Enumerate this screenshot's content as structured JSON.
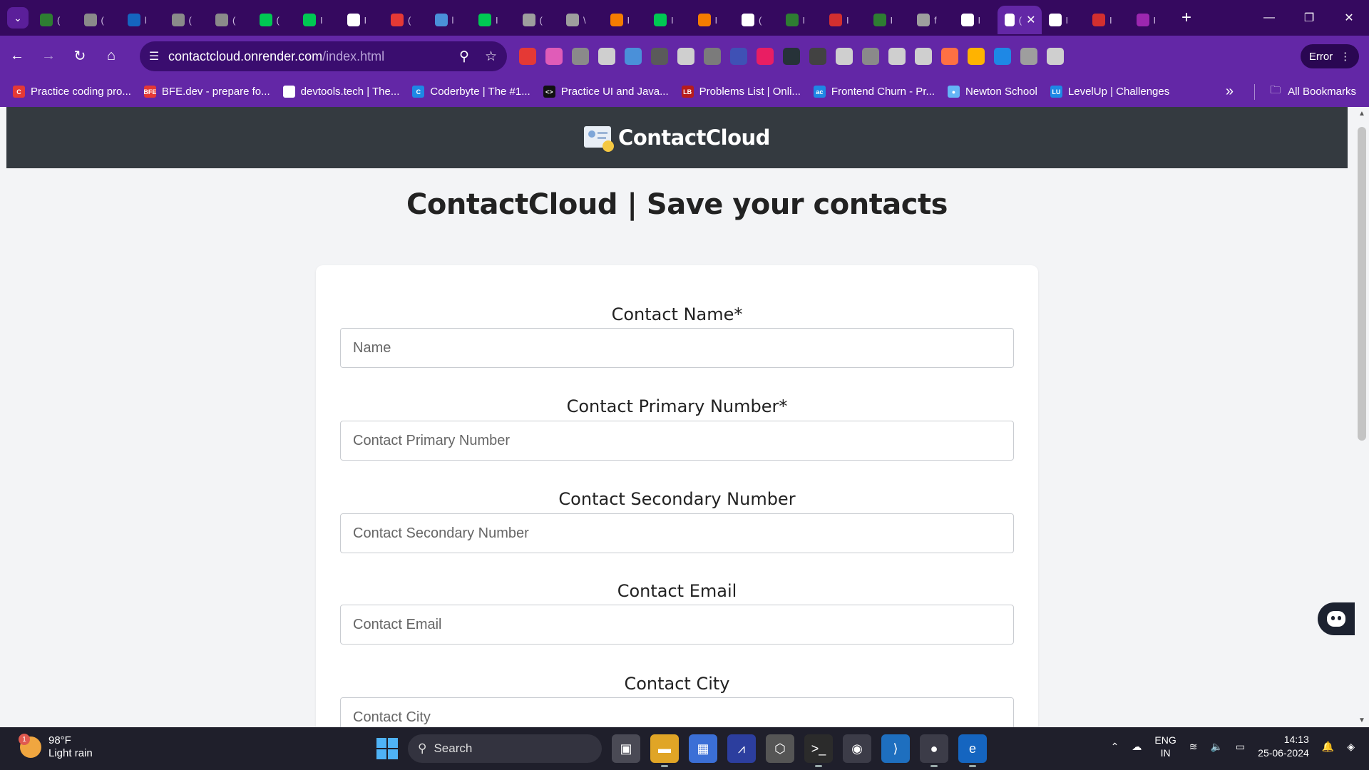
{
  "browser": {
    "tabs": [
      {
        "letter": "(",
        "color": "#2e7d32"
      },
      {
        "letter": "(",
        "color": "#8a8a8a"
      },
      {
        "letter": "l",
        "color": "#1565c0"
      },
      {
        "letter": "(",
        "color": "#8a8a8a"
      },
      {
        "letter": "(",
        "color": "#8a8a8a"
      },
      {
        "letter": "(",
        "color": "#00c853"
      },
      {
        "letter": "I",
        "color": "#00c853"
      },
      {
        "letter": "I",
        "color": "#ffffff"
      },
      {
        "letter": "(",
        "color": "#e53935"
      },
      {
        "letter": "l",
        "color": "#4a90d9"
      },
      {
        "letter": "I",
        "color": "#00c853"
      },
      {
        "letter": "(",
        "color": "#9e9e9e"
      },
      {
        "letter": "\\",
        "color": "#9e9e9e"
      },
      {
        "letter": "I",
        "color": "#f57c00"
      },
      {
        "letter": "I",
        "color": "#00c853"
      },
      {
        "letter": "I",
        "color": "#f57c00"
      },
      {
        "letter": "(",
        "color": "#ffffff"
      },
      {
        "letter": "I",
        "color": "#2e7d32"
      },
      {
        "letter": "I",
        "color": "#d32f2f"
      },
      {
        "letter": "I",
        "color": "#2e7d32"
      },
      {
        "letter": "f",
        "color": "#9e9e9e"
      },
      {
        "letter": "I",
        "color": "#ffffff"
      }
    ],
    "active_tab": {
      "letter": "(",
      "close": "✕"
    },
    "tabs_after": [
      {
        "letter": "I",
        "color": "#ffffff"
      },
      {
        "letter": "I",
        "color": "#d32f2f"
      },
      {
        "letter": "I",
        "color": "#9c27b0"
      }
    ],
    "url_host": "contactcloud.onrender.com",
    "url_path": "/index.html",
    "error_label": "Error",
    "extensions": [
      "#e53935",
      "#e05cb8",
      "#8a8a8a",
      "#cfcfcf",
      "#4a90d9",
      "#5a5a5a",
      "#cfcfcf",
      "#7b7b7b",
      "#3f51b5",
      "#e91e63",
      "#263238",
      "#424242",
      "#cfcfcf",
      "#8a8a8a",
      "#cfcfcf",
      "#cfcfcf",
      "#ff7043",
      "#ffb300",
      "#1e88e5",
      "#9e9e9e",
      "#cfcfcf"
    ]
  },
  "bookmarks": [
    {
      "label": "Practice coding pro...",
      "icon": "C",
      "color": "#e53935"
    },
    {
      "label": "BFE.dev - prepare fo...",
      "icon": "BFE",
      "color": "#e53935"
    },
    {
      "label": "devtools.tech | The...",
      "icon": "▭",
      "color": "#ffffff"
    },
    {
      "label": "Coderbyte | The #1...",
      "icon": "C",
      "color": "#1e88e5"
    },
    {
      "label": "Practice UI and Java...",
      "icon": "<>",
      "color": "#111111"
    },
    {
      "label": "Problems List | Onli...",
      "icon": "LB",
      "color": "#b71c1c"
    },
    {
      "label": "Frontend Churn - Pr...",
      "icon": "ac",
      "color": "#1e88e5"
    },
    {
      "label": "Newton School",
      "icon": "●",
      "color": "#64b5f6"
    },
    {
      "label": "LevelUp | Challenges",
      "icon": "LU",
      "color": "#1e88e5"
    }
  ],
  "bookmarks_all": "All Bookmarks",
  "site": {
    "brand": "ContactCloud",
    "title": "ContactCloud | Save your contacts",
    "fields": [
      {
        "label": "Contact Name*",
        "placeholder": "Name"
      },
      {
        "label": "Contact Primary Number*",
        "placeholder": "Contact Primary Number"
      },
      {
        "label": "Contact Secondary Number",
        "placeholder": "Contact Secondary Number"
      },
      {
        "label": "Contact Email",
        "placeholder": "Contact Email"
      },
      {
        "label": "Contact City",
        "placeholder": "Contact City"
      }
    ]
  },
  "taskbar": {
    "temp": "98°F",
    "condition": "Light rain",
    "weather_badge": "1",
    "search": "Search",
    "lang1": "ENG",
    "lang2": "IN",
    "time": "14:13",
    "date": "25-06-2024"
  }
}
